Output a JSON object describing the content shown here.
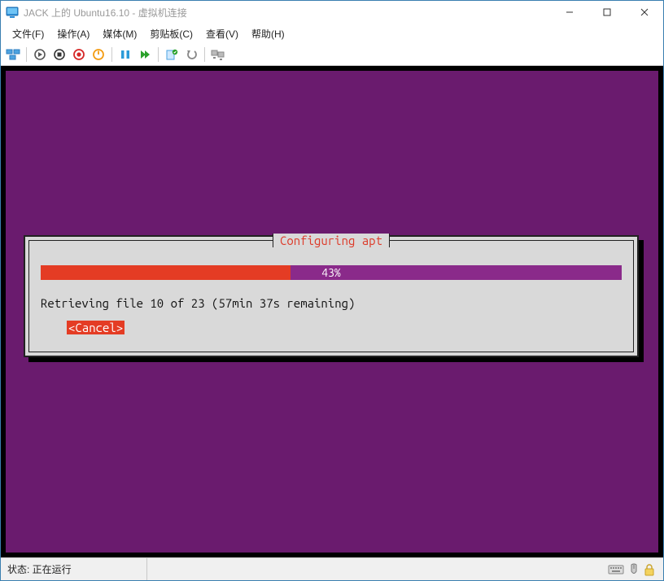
{
  "window": {
    "title": "JACK 上的 Ubuntu16.10 - 虚拟机连接"
  },
  "menu": {
    "file": "文件(F)",
    "action": "操作(A)",
    "media": "媒体(M)",
    "clipboard": "剪贴板(C)",
    "view": "查看(V)",
    "help": "帮助(H)"
  },
  "installer": {
    "title": "Configuring apt",
    "percent_label": "43%",
    "percent_value": 43,
    "status": "Retrieving file 10 of 23 (57min 37s remaining)",
    "cancel": "<Cancel>"
  },
  "statusbar": {
    "text": "状态: 正在运行"
  }
}
